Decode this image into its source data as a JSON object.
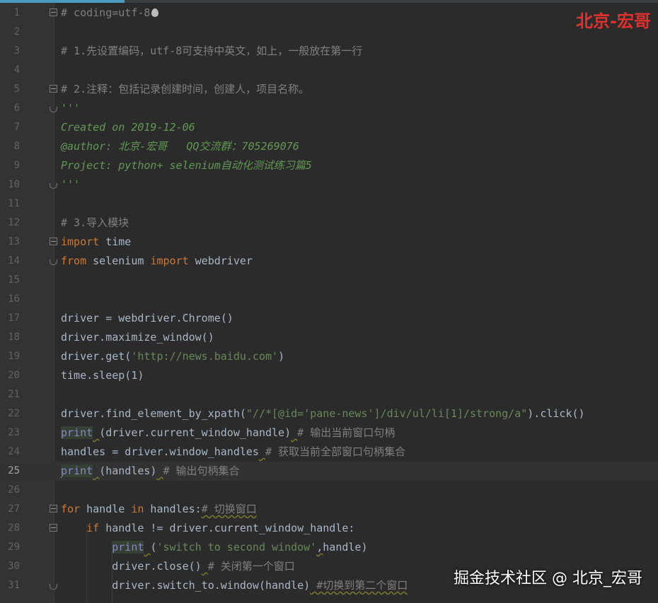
{
  "editor": {
    "lines": [
      {
        "n": "1",
        "segs": [
          {
            "t": "# coding=utf-8",
            "c": "cm"
          }
        ]
      },
      {
        "n": "2",
        "segs": []
      },
      {
        "n": "3",
        "segs": [
          {
            "t": "# 1.先设置编码，utf-8可支持中英文，如上，一般放在第一行",
            "c": "cm"
          }
        ]
      },
      {
        "n": "4",
        "segs": []
      },
      {
        "n": "5",
        "segs": [
          {
            "t": "# 2.注释：包括记录创建时间，创建人，项目名称。",
            "c": "cm"
          }
        ]
      },
      {
        "n": "6",
        "segs": [
          {
            "t": "'''",
            "c": "doc"
          }
        ]
      },
      {
        "n": "7",
        "segs": [
          {
            "t": "Created on 2019-12-06",
            "c": "doc"
          }
        ]
      },
      {
        "n": "8",
        "segs": [
          {
            "t": "@author: 北京-宏哥   QQ交流群：705269076",
            "c": "doc"
          }
        ]
      },
      {
        "n": "9",
        "segs": [
          {
            "t": "Project: python+ selenium自动化测试练习篇5",
            "c": "doc"
          }
        ]
      },
      {
        "n": "10",
        "segs": [
          {
            "t": "'''",
            "c": "doc"
          }
        ]
      },
      {
        "n": "11",
        "segs": []
      },
      {
        "n": "12",
        "segs": [
          {
            "t": "# 3.导入模块",
            "c": "cm"
          }
        ]
      },
      {
        "n": "13",
        "segs": [
          {
            "t": "import",
            "c": "kw"
          },
          {
            "t": " time",
            "c": ""
          }
        ]
      },
      {
        "n": "14",
        "segs": [
          {
            "t": "from",
            "c": "kw"
          },
          {
            "t": " selenium ",
            "c": ""
          },
          {
            "t": "import",
            "c": "kw"
          },
          {
            "t": " webdriver",
            "c": ""
          }
        ]
      },
      {
        "n": "15",
        "segs": []
      },
      {
        "n": "16",
        "segs": []
      },
      {
        "n": "17",
        "segs": [
          {
            "t": "driver = webdriver.Chrome()",
            "c": ""
          }
        ]
      },
      {
        "n": "18",
        "segs": [
          {
            "t": "driver.maximize_window()",
            "c": ""
          }
        ]
      },
      {
        "n": "19",
        "segs": [
          {
            "t": "driver.get(",
            "c": ""
          },
          {
            "t": "'http://news.baidu.com'",
            "c": "str"
          },
          {
            "t": ")",
            "c": ""
          }
        ]
      },
      {
        "n": "20",
        "segs": [
          {
            "t": "time.sleep(1)",
            "c": ""
          }
        ]
      },
      {
        "n": "21",
        "segs": []
      },
      {
        "n": "22",
        "segs": [
          {
            "t": "driver.find_element_by_xpath(",
            "c": ""
          },
          {
            "t": "\"//*[@id='pane-news']/div/ul/li[1]/strong/a\"",
            "c": "str"
          },
          {
            "t": ").click()",
            "c": ""
          }
        ]
      },
      {
        "n": "23",
        "segs": [
          {
            "t": "print",
            "c": "bi hl"
          },
          {
            "t": " ",
            "c": "sq"
          },
          {
            "t": "(driver.current_window_handle)",
            "c": ""
          },
          {
            "t": " ",
            "c": "sq"
          },
          {
            "t": "# 输出当前窗口句柄",
            "c": "cm"
          }
        ]
      },
      {
        "n": "24",
        "segs": [
          {
            "t": "handles = driver.window_handles",
            "c": ""
          },
          {
            "t": " ",
            "c": "sq"
          },
          {
            "t": "# 获取当前全部窗口句柄集合",
            "c": "cm"
          }
        ]
      },
      {
        "n": "25",
        "segs": [
          {
            "t": "print",
            "c": "bi hl"
          },
          {
            "t": " ",
            "c": "sq"
          },
          {
            "t": "(handles)",
            "c": ""
          },
          {
            "t": " ",
            "c": "sq"
          },
          {
            "t": "# 输出句柄集合",
            "c": "cm"
          }
        ]
      },
      {
        "n": "26",
        "segs": []
      },
      {
        "n": "27",
        "segs": [
          {
            "t": "for",
            "c": "kw"
          },
          {
            "t": " handle ",
            "c": ""
          },
          {
            "t": "in",
            "c": "kw"
          },
          {
            "t": " handles:",
            "c": ""
          },
          {
            "t": "# 切换窗口",
            "c": "cm sq"
          }
        ]
      },
      {
        "n": "28",
        "segs": [
          {
            "t": "    ",
            "c": ""
          },
          {
            "t": "if",
            "c": "kw"
          },
          {
            "t": " handle != driver.current_window_handle:",
            "c": ""
          }
        ]
      },
      {
        "n": "29",
        "segs": [
          {
            "t": "        ",
            "c": ""
          },
          {
            "t": "print",
            "c": "bi hl"
          },
          {
            "t": " ",
            "c": "sq"
          },
          {
            "t": "(",
            "c": ""
          },
          {
            "t": "'switch to second window'",
            "c": "str"
          },
          {
            "t": ",",
            "c": "sq"
          },
          {
            "t": "handle)",
            "c": ""
          }
        ]
      },
      {
        "n": "30",
        "segs": [
          {
            "t": "        driver.close()",
            "c": ""
          },
          {
            "t": " ",
            "c": "sq"
          },
          {
            "t": "# 关闭第一个窗口",
            "c": "cm"
          }
        ]
      },
      {
        "n": "31",
        "segs": [
          {
            "t": "        driver.switch_to.window(handle)",
            "c": ""
          },
          {
            "t": " ",
            "c": "sq"
          },
          {
            "t": "#切换到第二个窗口",
            "c": "cm sq"
          }
        ]
      }
    ]
  },
  "watermark": {
    "top": "北京-宏哥",
    "bottom": "掘金技术社区 @ 北京_宏哥",
    "top_color": "#e0312f"
  },
  "icons": {
    "line1_trailing": "inspection-bulb-icon"
  }
}
